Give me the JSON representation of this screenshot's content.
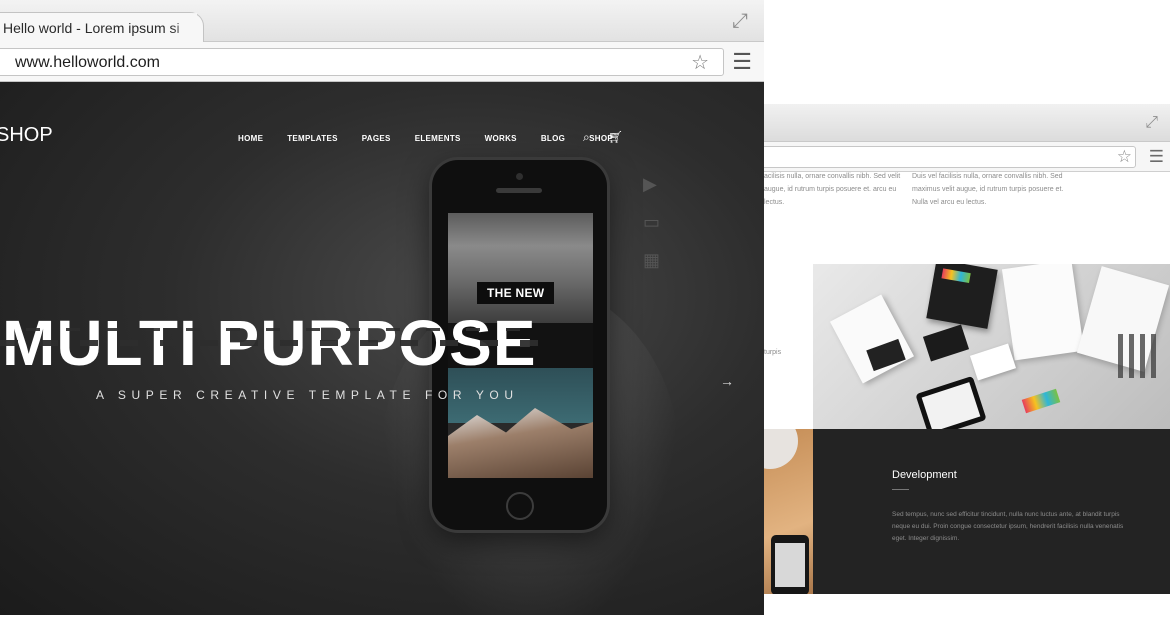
{
  "front_browser": {
    "tab_title": "Hello world - Lorem ipsum sip",
    "url": "www.helloworld.com",
    "icons": {
      "expand": "expand-icon",
      "bookmark": "star-icon",
      "menu": "hamburger-menu-icon"
    }
  },
  "site": {
    "logo": "SHOP",
    "nav": [
      "HOME",
      "TEMPLATES",
      "PAGES",
      "ELEMENTS",
      "WORKS",
      "BLOG",
      "SHOP"
    ],
    "nav_icons": [
      "search-icon",
      "cart-icon"
    ],
    "side_icons": [
      "film-icon",
      "monitor-icon",
      "image-icon"
    ],
    "badge": "THE NEW",
    "title": "MULTI PURPOSE",
    "subtitle": "A SUPER CREATIVE TEMPLATE FOR YOU",
    "next_arrow": "→"
  },
  "back_browser": {
    "lorem_left": "acilisis nulla, ornare convallis nibh. Sed velit augue, id rutrum turpis posuere et. arcu eu lectus.",
    "lorem_right": "Duis vel facilisis nulla, ornare convallis nibh. Sed maximus velit augue, id rutrum turpis posuere et. Nulla vel arcu eu lectus.",
    "lorem_turpis": "turpis",
    "development_title": "Development",
    "development_text": "Sed tempus, nunc sed efficitur tincidunt, nulla nunc luctus ante, at blandit turpis neque eu dui. Proin congue consectetur ipsum, hendrerit facilisis nulla venenatis eget. Integer dignissim."
  }
}
